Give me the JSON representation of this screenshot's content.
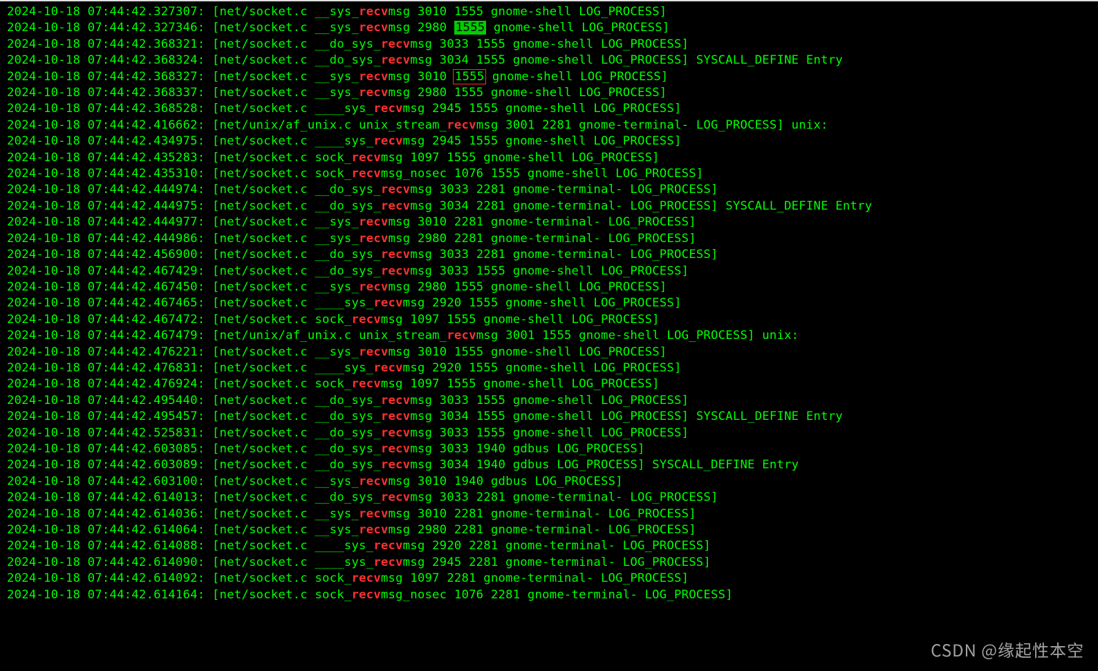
{
  "highlight_word": "recv",
  "watermark": "CSDN @缘起性本空",
  "lines": [
    {
      "ts": "2024-10-18 07:44:42.327307",
      "src": "net/socket.c",
      "pre": "__sys_",
      "post": "msg 3010 1555 gnome-shell LOG_PROCESS]",
      "mark": "none",
      "mark_after": ""
    },
    {
      "ts": "2024-10-18 07:44:42.327346",
      "src": "net/socket.c",
      "pre": "__sys_",
      "post": "msg 2980 ",
      "mark": "green",
      "mark_text": "1555",
      "mark_after": " gnome-shell LOG_PROCESS]"
    },
    {
      "ts": "2024-10-18 07:44:42.368321",
      "src": "net/socket.c",
      "pre": "__do_sys_",
      "post": "msg 3033 1555 gnome-shell LOG_PROCESS]",
      "mark": "none",
      "mark_after": ""
    },
    {
      "ts": "2024-10-18 07:44:42.368324",
      "src": "net/socket.c",
      "pre": "__do_sys_",
      "post": "msg 3034 1555 gnome-shell LOG_PROCESS] SYSCALL_DEFINE Entry",
      "mark": "none",
      "mark_after": ""
    },
    {
      "ts": "2024-10-18 07:44:42.368327",
      "src": "net/socket.c",
      "pre": "__sys_",
      "post": "msg 3010 ",
      "mark": "redbox",
      "mark_text": "1555",
      "mark_after": " gnome-shell LOG_PROCESS]"
    },
    {
      "ts": "2024-10-18 07:44:42.368337",
      "src": "net/socket.c",
      "pre": "__sys_",
      "post": "msg 2980 1555 gnome-shell LOG_PROCESS]",
      "mark": "none",
      "mark_after": ""
    },
    {
      "ts": "2024-10-18 07:44:42.368528",
      "src": "net/socket.c",
      "pre": "____sys_",
      "post": "msg 2945 1555 gnome-shell LOG_PROCESS]",
      "mark": "none",
      "mark_after": ""
    },
    {
      "ts": "2024-10-18 07:44:42.416662",
      "src": "net/unix/af_unix.c",
      "pre": "unix_stream_",
      "post": "msg 3001 2281 gnome-terminal- LOG_PROCESS] unix:",
      "mark": "none",
      "mark_after": ""
    },
    {
      "ts": "2024-10-18 07:44:42.434975",
      "src": "net/socket.c",
      "pre": "____sys_",
      "post": "msg 2945 1555 gnome-shell LOG_PROCESS]",
      "mark": "none",
      "mark_after": ""
    },
    {
      "ts": "2024-10-18 07:44:42.435283",
      "src": "net/socket.c",
      "pre": "sock_",
      "post": "msg 1097 1555 gnome-shell LOG_PROCESS]",
      "mark": "none",
      "mark_after": ""
    },
    {
      "ts": "2024-10-18 07:44:42.435310",
      "src": "net/socket.c",
      "pre": "sock_",
      "post": "msg_nosec 1076 1555 gnome-shell LOG_PROCESS]",
      "mark": "none",
      "mark_after": ""
    },
    {
      "ts": "2024-10-18 07:44:42.444974",
      "src": "net/socket.c",
      "pre": "__do_sys_",
      "post": "msg 3033 2281 gnome-terminal- LOG_PROCESS]",
      "mark": "none",
      "mark_after": ""
    },
    {
      "ts": "2024-10-18 07:44:42.444975",
      "src": "net/socket.c",
      "pre": "__do_sys_",
      "post": "msg 3034 2281 gnome-terminal- LOG_PROCESS] SYSCALL_DEFINE Entry",
      "mark": "none",
      "mark_after": ""
    },
    {
      "ts": "2024-10-18 07:44:42.444977",
      "src": "net/socket.c",
      "pre": "__sys_",
      "post": "msg 3010 2281 gnome-terminal- LOG_PROCESS]",
      "mark": "none",
      "mark_after": ""
    },
    {
      "ts": "2024-10-18 07:44:42.444986",
      "src": "net/socket.c",
      "pre": "__sys_",
      "post": "msg 2980 2281 gnome-terminal- LOG_PROCESS]",
      "mark": "none",
      "mark_after": ""
    },
    {
      "ts": "2024-10-18 07:44:42.456900",
      "src": "net/socket.c",
      "pre": "__do_sys_",
      "post": "msg 3033 2281 gnome-terminal- LOG_PROCESS]",
      "mark": "none",
      "mark_after": ""
    },
    {
      "ts": "2024-10-18 07:44:42.467429",
      "src": "net/socket.c",
      "pre": "__do_sys_",
      "post": "msg 3033 1555 gnome-shell LOG_PROCESS]",
      "mark": "none",
      "mark_after": ""
    },
    {
      "ts": "2024-10-18 07:44:42.467450",
      "src": "net/socket.c",
      "pre": "__sys_",
      "post": "msg 2980 1555 gnome-shell LOG_PROCESS]",
      "mark": "none",
      "mark_after": ""
    },
    {
      "ts": "2024-10-18 07:44:42.467465",
      "src": "net/socket.c",
      "pre": "____sys_",
      "post": "msg 2920 1555 gnome-shell LOG_PROCESS]",
      "mark": "none",
      "mark_after": ""
    },
    {
      "ts": "2024-10-18 07:44:42.467472",
      "src": "net/socket.c",
      "pre": "sock_",
      "post": "msg 1097 1555 gnome-shell LOG_PROCESS]",
      "mark": "none",
      "mark_after": ""
    },
    {
      "ts": "2024-10-18 07:44:42.467479",
      "src": "net/unix/af_unix.c",
      "pre": "unix_stream_",
      "post": "msg 3001 1555 gnome-shell LOG_PROCESS] unix:",
      "mark": "none",
      "mark_after": ""
    },
    {
      "ts": "2024-10-18 07:44:42.476221",
      "src": "net/socket.c",
      "pre": "__sys_",
      "post": "msg 3010 1555 gnome-shell LOG_PROCESS]",
      "mark": "none",
      "mark_after": ""
    },
    {
      "ts": "2024-10-18 07:44:42.476831",
      "src": "net/socket.c",
      "pre": "____sys_",
      "post": "msg 2920 1555 gnome-shell LOG_PROCESS]",
      "mark": "none",
      "mark_after": ""
    },
    {
      "ts": "2024-10-18 07:44:42.476924",
      "src": "net/socket.c",
      "pre": "sock_",
      "post": "msg 1097 1555 gnome-shell LOG_PROCESS]",
      "mark": "none",
      "mark_after": ""
    },
    {
      "ts": "2024-10-18 07:44:42.495440",
      "src": "net/socket.c",
      "pre": "__do_sys_",
      "post": "msg 3033 1555 gnome-shell LOG_PROCESS]",
      "mark": "none",
      "mark_after": ""
    },
    {
      "ts": "2024-10-18 07:44:42.495457",
      "src": "net/socket.c",
      "pre": "__do_sys_",
      "post": "msg 3034 1555 gnome-shell LOG_PROCESS] SYSCALL_DEFINE Entry",
      "mark": "none",
      "mark_after": ""
    },
    {
      "ts": "2024-10-18 07:44:42.525831",
      "src": "net/socket.c",
      "pre": "__do_sys_",
      "post": "msg 3033 1555 gnome-shell LOG_PROCESS]",
      "mark": "none",
      "mark_after": ""
    },
    {
      "ts": "2024-10-18 07:44:42.603085",
      "src": "net/socket.c",
      "pre": "__do_sys_",
      "post": "msg 3033 1940 gdbus LOG_PROCESS]",
      "mark": "none",
      "mark_after": ""
    },
    {
      "ts": "2024-10-18 07:44:42.603089",
      "src": "net/socket.c",
      "pre": "__do_sys_",
      "post": "msg 3034 1940 gdbus LOG_PROCESS] SYSCALL_DEFINE Entry",
      "mark": "none",
      "mark_after": ""
    },
    {
      "ts": "2024-10-18 07:44:42.603100",
      "src": "net/socket.c",
      "pre": "__sys_",
      "post": "msg 3010 1940 gdbus LOG_PROCESS]",
      "mark": "none",
      "mark_after": ""
    },
    {
      "ts": "2024-10-18 07:44:42.614013",
      "src": "net/socket.c",
      "pre": "__do_sys_",
      "post": "msg 3033 2281 gnome-terminal- LOG_PROCESS]",
      "mark": "none",
      "mark_after": ""
    },
    {
      "ts": "2024-10-18 07:44:42.614036",
      "src": "net/socket.c",
      "pre": "__sys_",
      "post": "msg 3010 2281 gnome-terminal- LOG_PROCESS]",
      "mark": "none",
      "mark_after": ""
    },
    {
      "ts": "2024-10-18 07:44:42.614064",
      "src": "net/socket.c",
      "pre": "__sys_",
      "post": "msg 2980 2281 gnome-terminal- LOG_PROCESS]",
      "mark": "none",
      "mark_after": ""
    },
    {
      "ts": "2024-10-18 07:44:42.614088",
      "src": "net/socket.c",
      "pre": "____sys_",
      "post": "msg 2920 2281 gnome-terminal- LOG_PROCESS]",
      "mark": "none",
      "mark_after": ""
    },
    {
      "ts": "2024-10-18 07:44:42.614090",
      "src": "net/socket.c",
      "pre": "____sys_",
      "post": "msg 2945 2281 gnome-terminal- LOG_PROCESS]",
      "mark": "none",
      "mark_after": ""
    },
    {
      "ts": "2024-10-18 07:44:42.614092",
      "src": "net/socket.c",
      "pre": "sock_",
      "post": "msg 1097 2281 gnome-terminal- LOG_PROCESS]",
      "mark": "none",
      "mark_after": ""
    },
    {
      "ts": "2024-10-18 07:44:42.614164",
      "src": "net/socket.c",
      "pre": "sock_",
      "post": "msg_nosec 1076 2281 gnome-terminal- LOG_PROCESS]",
      "mark": "none",
      "mark_after": ""
    }
  ]
}
